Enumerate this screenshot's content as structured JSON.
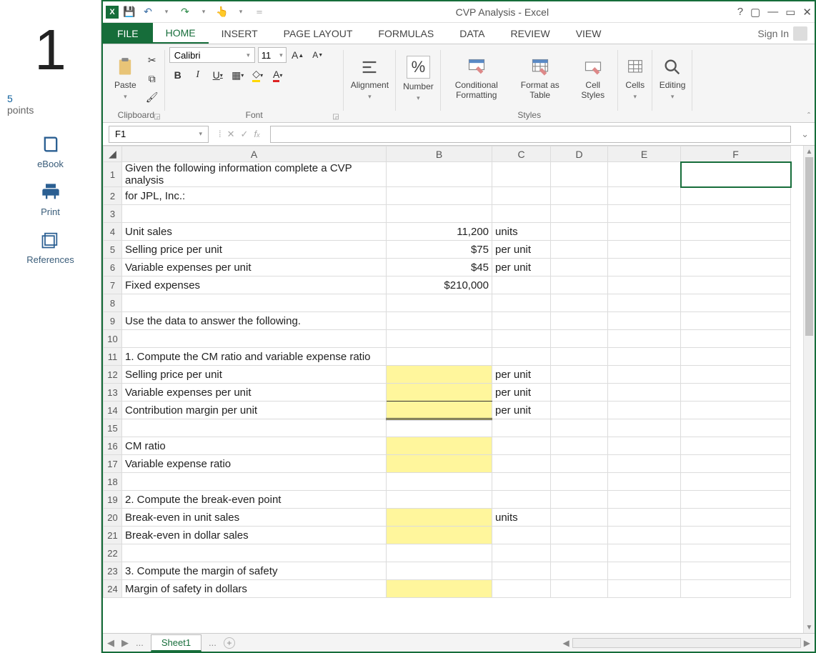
{
  "sidebar": {
    "points_value": "1",
    "points_label_top": "5",
    "points_label_bottom": "points",
    "ebook": "eBook",
    "print": "Print",
    "references": "References"
  },
  "titlebar": {
    "title": "CVP Analysis - Excel",
    "sign_in": "Sign In"
  },
  "tabs": {
    "file": "FILE",
    "home": "HOME",
    "insert": "INSERT",
    "page_layout": "PAGE LAYOUT",
    "formulas": "FORMULAS",
    "data": "DATA",
    "review": "REVIEW",
    "view": "VIEW"
  },
  "ribbon": {
    "paste": "Paste",
    "clipboard": "Clipboard",
    "font": "Font",
    "font_name": "Calibri",
    "font_size": "11",
    "alignment": "Alignment",
    "number": "Number",
    "number_icon": "%",
    "cond_fmt": "Conditional Formatting",
    "fmt_table": "Format as Table",
    "cell_styles": "Cell Styles",
    "styles": "Styles",
    "cells": "Cells",
    "editing": "Editing"
  },
  "name_box": "F1",
  "columns": [
    "A",
    "B",
    "C",
    "D",
    "E",
    "F"
  ],
  "rows": [
    {
      "A": "Given the following information complete a CVP analysis"
    },
    {
      "A": "for JPL, Inc.:"
    },
    {},
    {
      "A": "Unit sales",
      "B": "11,200",
      "C": "units"
    },
    {
      "A": "Selling price per unit",
      "B": "$75",
      "C": "per unit"
    },
    {
      "A": "Variable expenses per unit",
      "B": "$45",
      "C": "per unit"
    },
    {
      "A": "Fixed expenses",
      "B": "$210,000"
    },
    {},
    {
      "A": "Use the data to answer the following."
    },
    {},
    {
      "A": "1. Compute the CM ratio and variable expense ratio"
    },
    {
      "A": "Selling price per unit",
      "Bhl": true,
      "C": "per unit"
    },
    {
      "A": "Variable expenses per unit",
      "Bhl": true,
      "C": "per unit",
      "bb": "thin"
    },
    {
      "A": "Contribution margin per unit",
      "Bhl": true,
      "C": "per unit",
      "bb": "double"
    },
    {},
    {
      "A": "CM ratio",
      "Bhl": true
    },
    {
      "A": "Variable expense ratio",
      "Bhl": true
    },
    {},
    {
      "A": "2. Compute the break-even point"
    },
    {
      "A": "Break-even in unit sales",
      "Bhl": true,
      "C": "units"
    },
    {
      "A": "Break-even in dollar sales",
      "Bhl": true
    },
    {},
    {
      "A": "3. Compute the margin of safety"
    },
    {
      "A": "Margin of safety in dollars",
      "Bhl": true
    }
  ],
  "sheet_tab": "Sheet1",
  "sheet_tab2": "...",
  "active_cell": {
    "row": 1,
    "col": "F"
  }
}
